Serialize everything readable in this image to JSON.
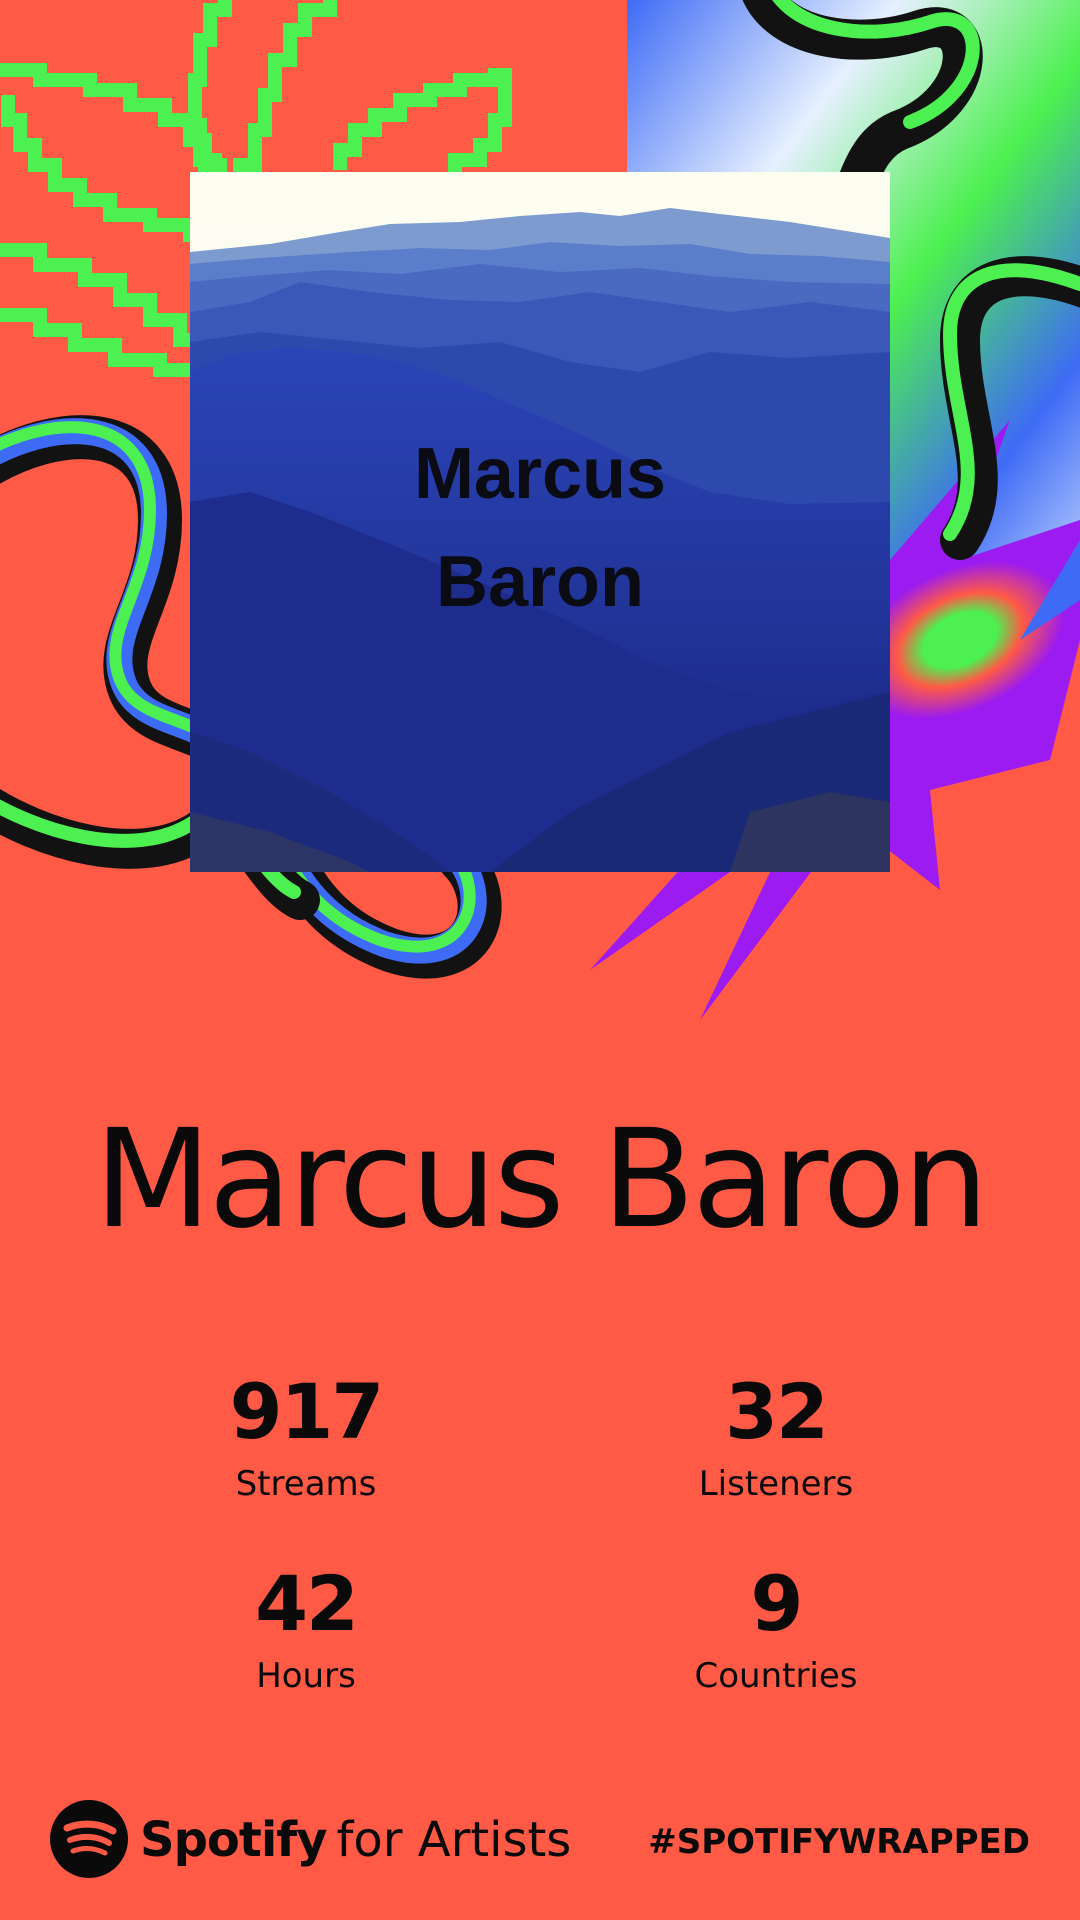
{
  "cover": {
    "overlay_name_line1": "Marcus",
    "overlay_name_line2": "Baron",
    "image_description_icon": "mountain-landscape"
  },
  "artist": {
    "name": "Marcus Baron"
  },
  "stats": [
    {
      "value": "917",
      "label": "Streams"
    },
    {
      "value": "32",
      "label": "Listeners"
    },
    {
      "value": "42",
      "label": "Hours"
    },
    {
      "value": "9",
      "label": "Countries"
    }
  ],
  "footer": {
    "brand_bold": "Spotify",
    "brand_light": "for Artists",
    "hashtag": "#SPOTIFYWRAPPED"
  },
  "colors": {
    "background": "#FF5A45",
    "accent_green": "#4CF050",
    "accent_purple": "#9B1BF0",
    "text": "#0A0A0A"
  }
}
